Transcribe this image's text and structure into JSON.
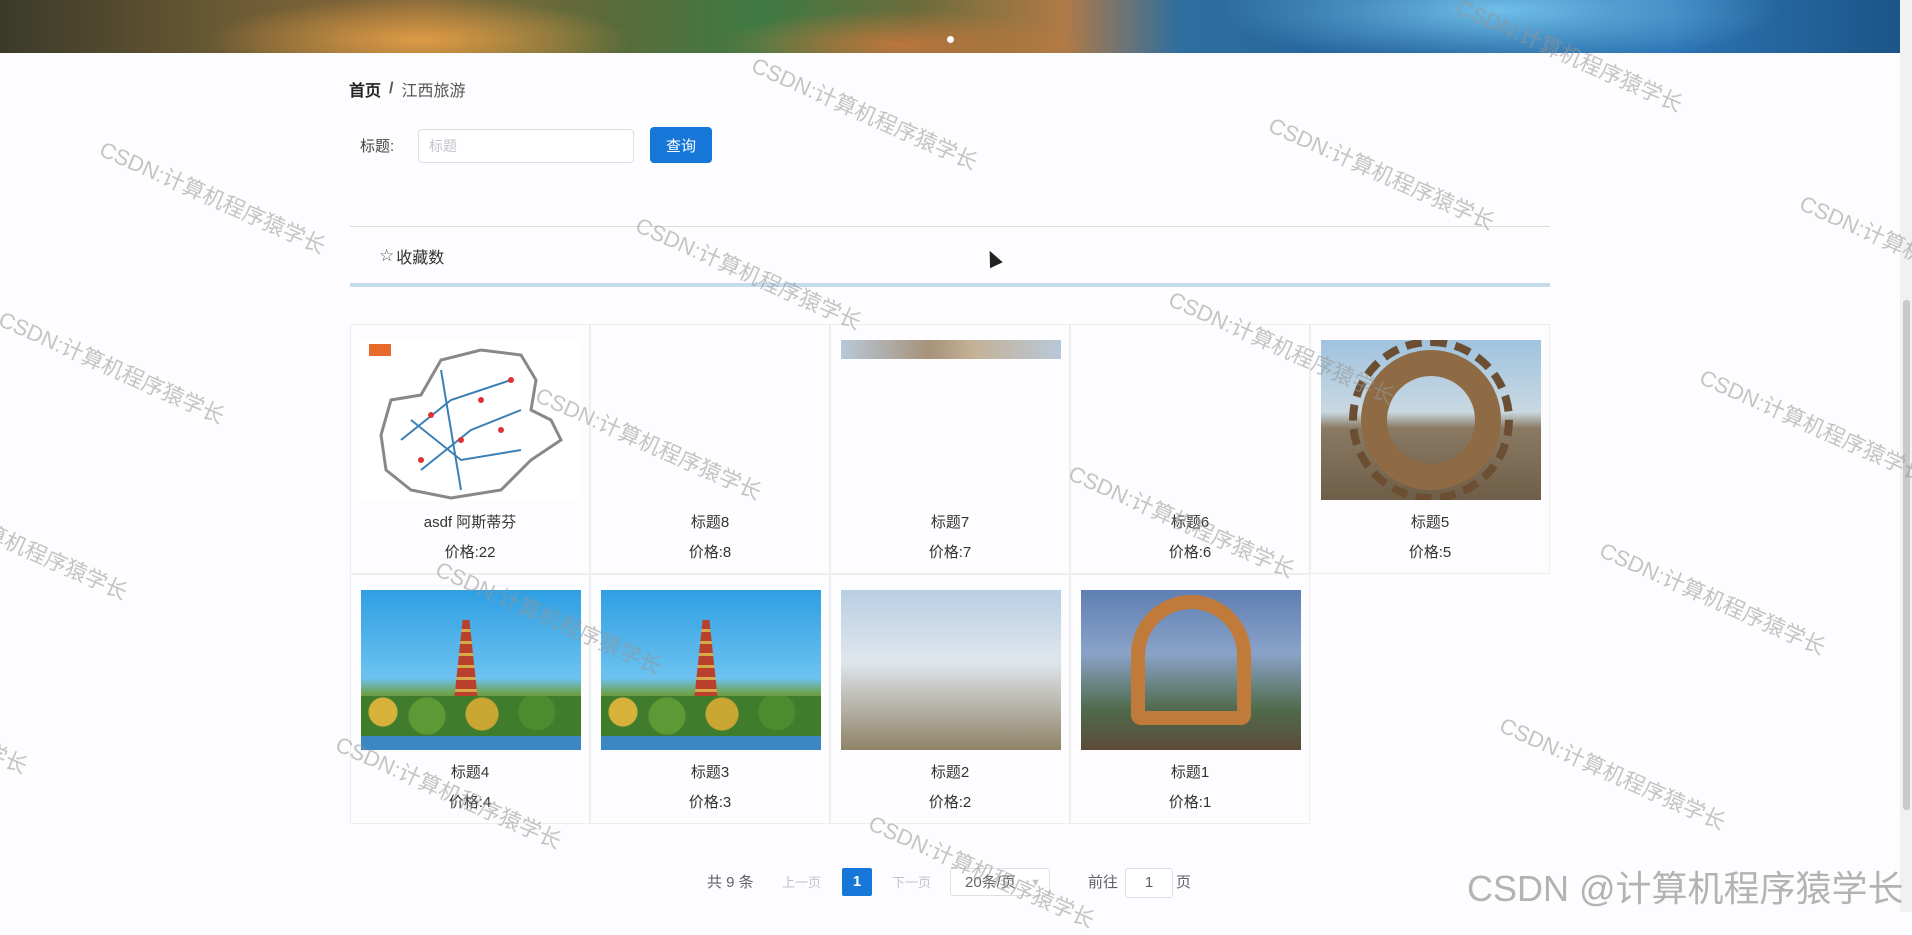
{
  "breadcrumb": {
    "home": "首页",
    "separator": "/",
    "current": "江西旅游"
  },
  "search": {
    "label": "标题:",
    "placeholder": "标题",
    "value": "",
    "button": "查询"
  },
  "sort": {
    "label": "收藏数",
    "icon": "star-outline-icon"
  },
  "cards": [
    {
      "title": "asdf 阿斯蒂芬",
      "price": "价格:22",
      "image": "map"
    },
    {
      "title": "标题8",
      "price": "价格:8",
      "image": "none"
    },
    {
      "title": "标题7",
      "price": "价格:7",
      "image": "strip"
    },
    {
      "title": "标题6",
      "price": "价格:6",
      "image": "none"
    },
    {
      "title": "标题5",
      "price": "价格:5",
      "image": "nest"
    },
    {
      "title": "标题4",
      "price": "价格:4",
      "image": "pagoda"
    },
    {
      "title": "标题3",
      "price": "价格:3",
      "image": "pagoda"
    },
    {
      "title": "标题2",
      "price": "价格:2",
      "image": "nest"
    },
    {
      "title": "标题1",
      "price": "价格:1",
      "image": "heart"
    }
  ],
  "pagination": {
    "total": "共 9 条",
    "prev": "上一页",
    "current_page": "1",
    "next": "下一页",
    "page_size": "20条/页",
    "goto_label": "前往",
    "goto_value": "1",
    "page_suffix": "页"
  },
  "watermark": {
    "text": "CSDN:计算机程序猿学长",
    "corner": "CSDN @计算机程序猿学长"
  },
  "colors": {
    "primary": "#1677d9",
    "sort_underline": "#c5dcef"
  }
}
